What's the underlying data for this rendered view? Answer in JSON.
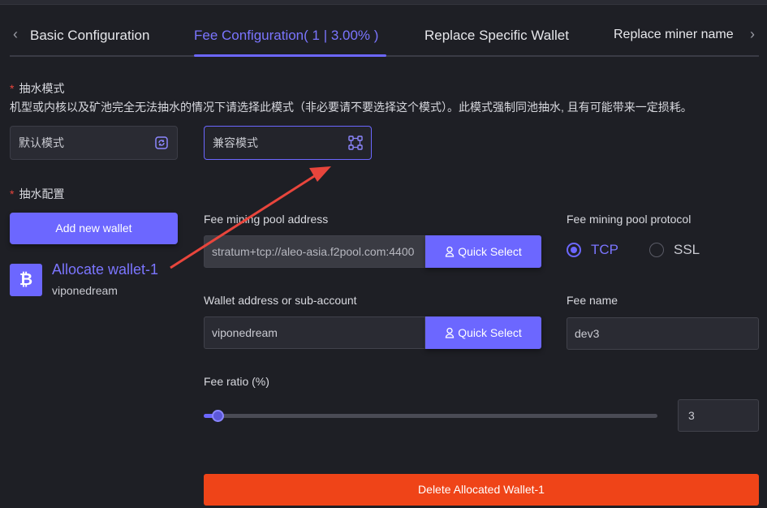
{
  "tabs": {
    "prev_icon": "chevron-left-icon",
    "next_icon": "chevron-right-icon",
    "items": [
      {
        "label": "Basic Configuration"
      },
      {
        "label": "Fee Configuration( 1 | 3.00% )"
      },
      {
        "label": "Replace Specific Wallet"
      },
      {
        "label": "Replace miner name"
      }
    ],
    "active_index": 1
  },
  "mode_section": {
    "required_mark": "*",
    "title": "抽水模式",
    "description": "机型或内核以及矿池完全无法抽水的情况下请选择此模式（非必要请不要选择这个模式）。此模式强制同池抽水, 且有可能带来一定损耗。",
    "options": [
      {
        "label": "默认模式",
        "icon": "cycle-icon",
        "selected": false
      },
      {
        "label": "兼容模式",
        "icon": "network-nodes-icon",
        "selected": true
      }
    ]
  },
  "config_section": {
    "required_mark": "*",
    "title": "抽水配置"
  },
  "wallets": {
    "add_label": "Add new wallet",
    "items": [
      {
        "name": "Allocate wallet-1",
        "sub": "viponedream",
        "icon": "bitcoin-icon",
        "badge": "₿"
      }
    ]
  },
  "form": {
    "pool_address_label": "Fee mining pool address",
    "pool_address_value": "stratum+tcp://aleo-asia.f2pool.com:4400",
    "quick_select_label": "Quick Select",
    "protocol_label": "Fee mining pool protocol",
    "protocols": [
      {
        "label": "TCP",
        "selected": true
      },
      {
        "label": "SSL",
        "selected": false
      }
    ],
    "wallet_label": "Wallet address or sub-account",
    "wallet_value": "viponedream",
    "fee_name_label": "Fee name",
    "fee_name_value": "dev3",
    "ratio_label": "Fee ratio (%)",
    "ratio_value": "3",
    "ratio_fraction": 0.03,
    "delete_label": "Delete Allocated Wallet-1"
  },
  "colors": {
    "accent": "#6c67ff",
    "danger": "#ef4418",
    "annotation_arrow": "#e8453c",
    "background": "#1e1f25"
  }
}
